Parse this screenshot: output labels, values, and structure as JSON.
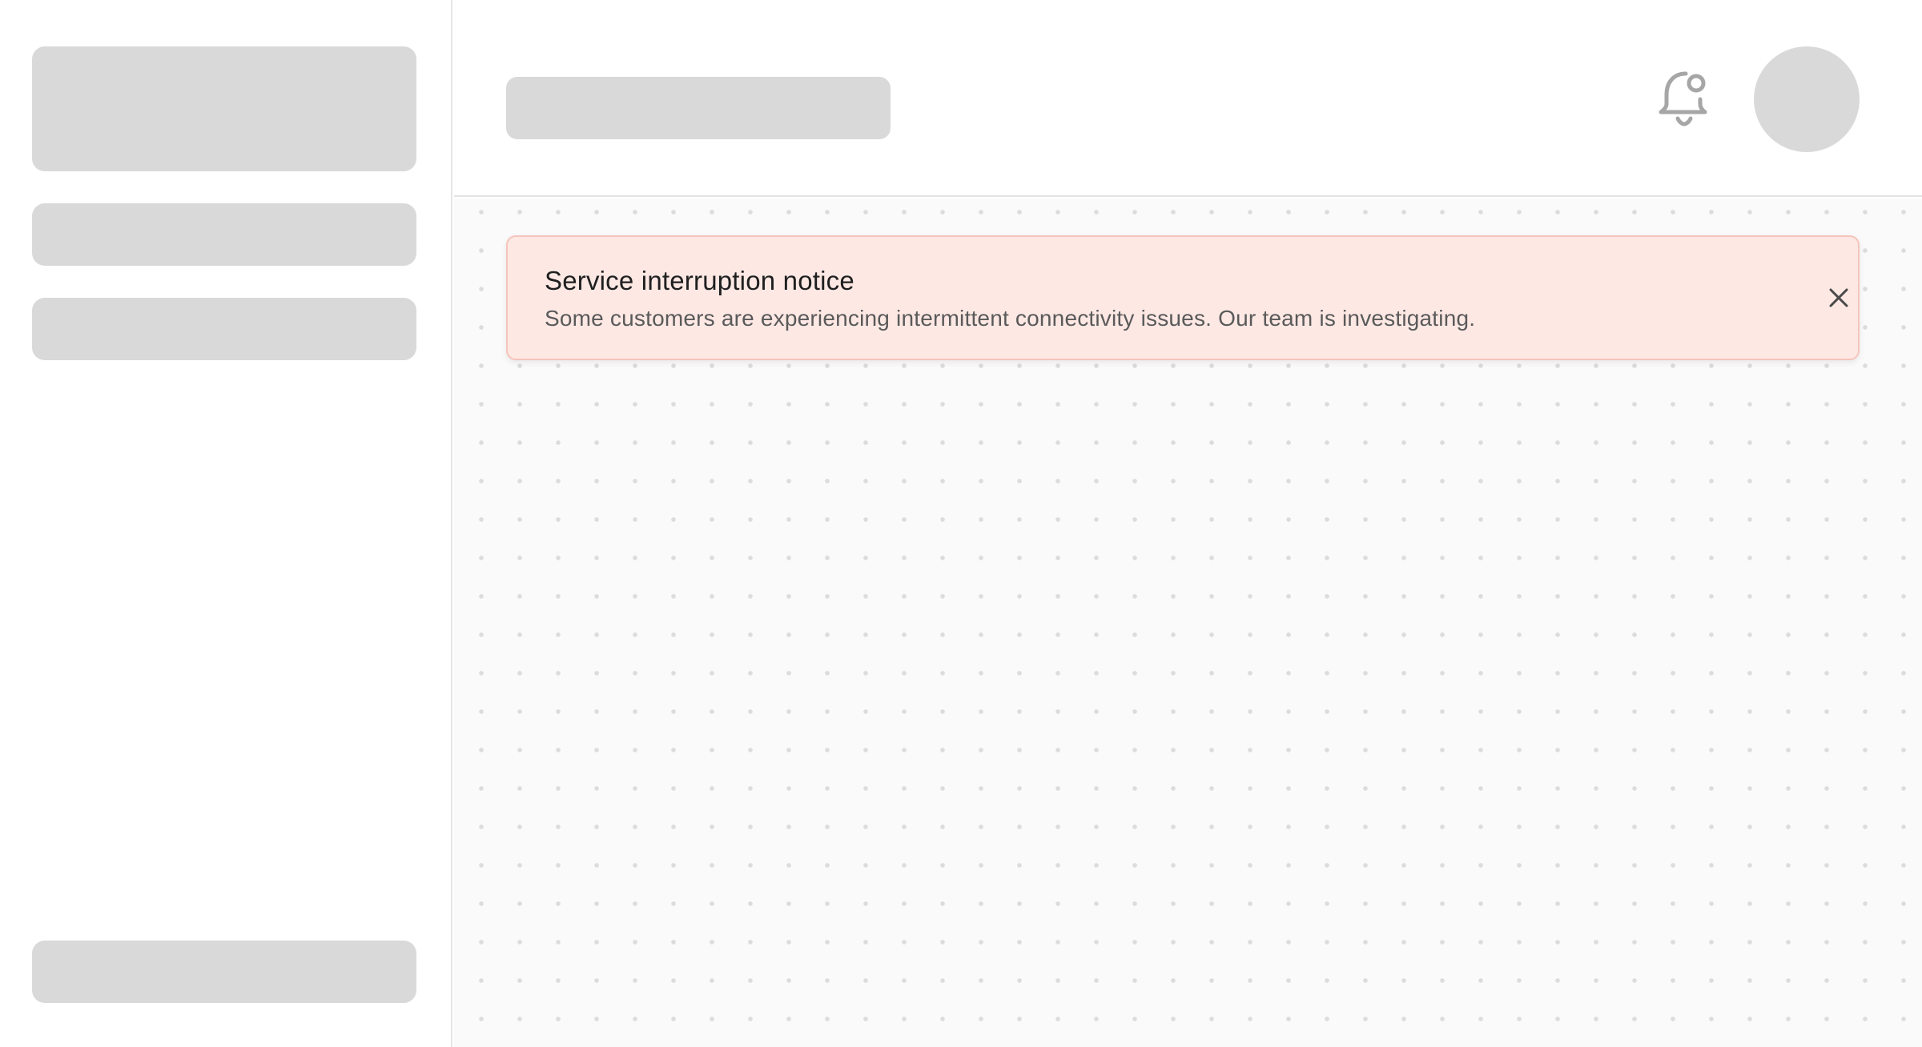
{
  "icons": {
    "notifications": "bell-with-dot-icon",
    "close": "close-icon"
  },
  "alert": {
    "title": "Service interruption notice",
    "message": "Some customers are experiencing intermittent connectivity issues. Our team is investigating."
  },
  "colors": {
    "alert_background": "#fde8e4",
    "alert_border": "#f6c4bb",
    "skeleton": "#d9d9d9"
  }
}
